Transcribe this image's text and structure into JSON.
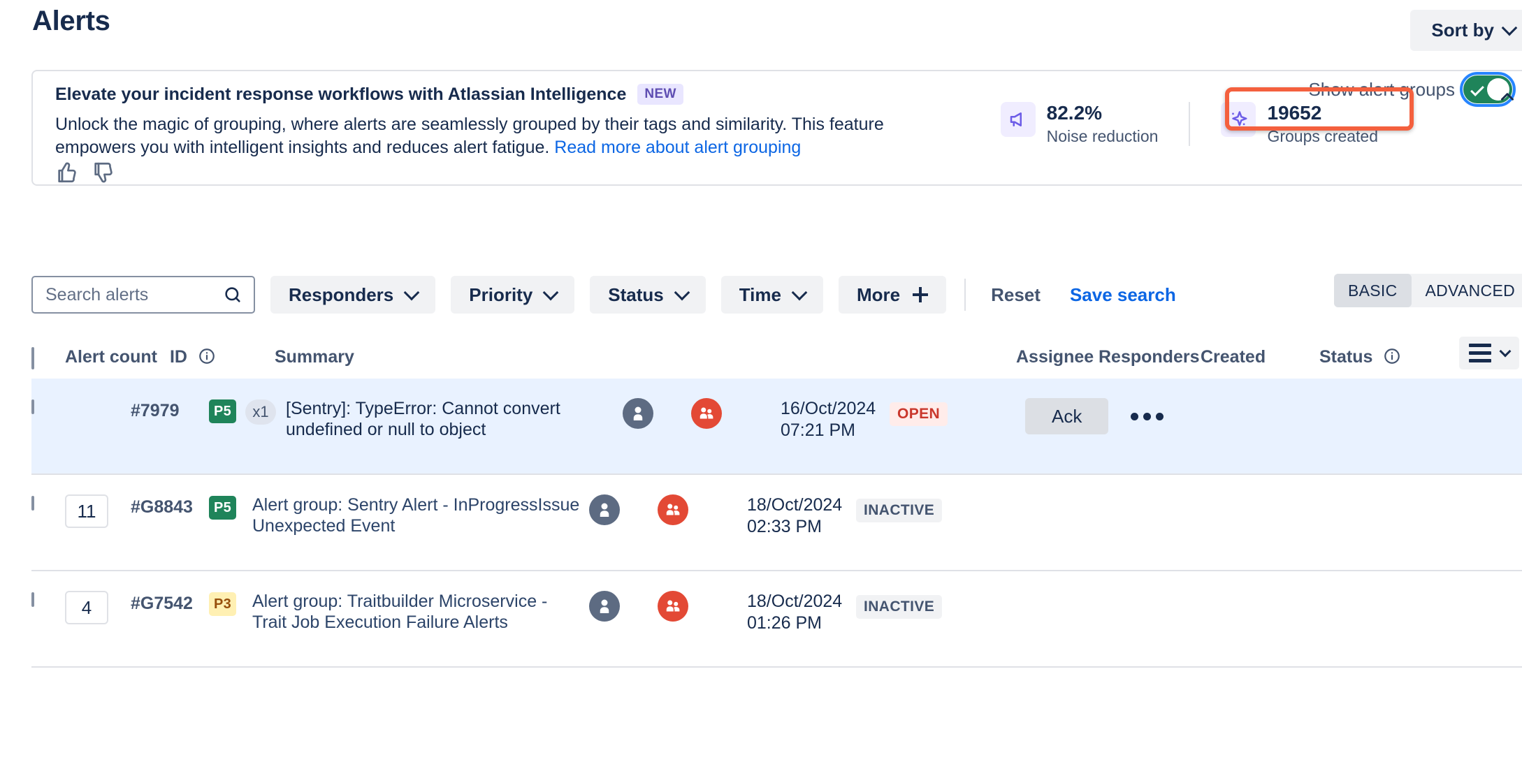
{
  "header": {
    "title": "Alerts",
    "sort_by_label": "Sort by"
  },
  "banner": {
    "title": "Elevate your incident response workflows with Atlassian Intelligence",
    "new_badge": "NEW",
    "body_part1": "Unlock the magic of grouping, where alerts are seamlessly grouped by their tags and similarity. This feature empowers you with intelligent insights and reduces alert fatigue. ",
    "link_text": "Read more about alert grouping",
    "stats": [
      {
        "value": "82.2%",
        "label": "Noise reduction",
        "icon": "megaphone-icon"
      },
      {
        "value": "19652",
        "label": "Groups created",
        "icon": "sparkle-icon"
      }
    ],
    "toggle_label": "Show alert groups",
    "toggle_on": true
  },
  "filters": {
    "search_placeholder": "Search alerts",
    "search_value": "",
    "buttons": [
      {
        "label": "Responders",
        "type": "dropdown"
      },
      {
        "label": "Priority",
        "type": "dropdown"
      },
      {
        "label": "Status",
        "type": "dropdown"
      },
      {
        "label": "Time",
        "type": "dropdown"
      },
      {
        "label": "More",
        "type": "plus"
      }
    ],
    "reset_label": "Reset",
    "save_search_label": "Save search",
    "mode_basic": "BASIC",
    "mode_advanced": "ADVANCED",
    "mode_selected": "BASIC"
  },
  "table": {
    "columns": {
      "alert_count": "Alert count",
      "id": "ID",
      "summary": "Summary",
      "assignee": "Assignee",
      "responders": "Responders",
      "created": "Created",
      "status": "Status"
    },
    "rows": [
      {
        "selected": true,
        "count": "",
        "id": "#7979",
        "priority": "P5",
        "priority_class": "p5",
        "times": "x1",
        "summary": "[Sentry]: TypeError: Cannot convert undefined or null to object",
        "created_date": "16/Oct/2024",
        "created_time": "07:21 PM",
        "status": "OPEN",
        "status_class": "open",
        "ack_label": "Ack"
      },
      {
        "selected": false,
        "count": "11",
        "id": "#G8843",
        "priority": "P5",
        "priority_class": "p5",
        "times": "",
        "summary": "Alert group: Sentry Alert - InProgressIssue Unexpected Event",
        "created_date": "18/Oct/2024",
        "created_time": "02:33 PM",
        "status": "INACTIVE",
        "status_class": "inactive",
        "ack_label": ""
      },
      {
        "selected": false,
        "count": "4",
        "id": "#G7542",
        "priority": "P3",
        "priority_class": "p3",
        "times": "",
        "summary": "Alert group: Traitbuilder Microservice - Trait Job Execution Failure Alerts",
        "created_date": "18/Oct/2024",
        "created_time": "01:26 PM",
        "status": "INACTIVE",
        "status_class": "inactive",
        "ack_label": ""
      }
    ]
  },
  "colors": {
    "accent_link": "#0c66e4",
    "highlight_box": "#f4603e",
    "toggle_on": "#1f845a",
    "selected_row": "#e9f2ff",
    "priority_p5": "#1f845a",
    "priority_p3": "#fff0b3",
    "status_open": "#c9372c",
    "responder_avatar": "#e34935"
  }
}
